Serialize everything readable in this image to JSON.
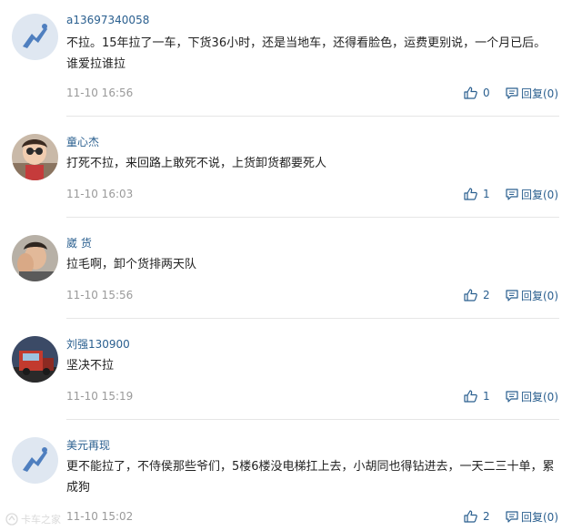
{
  "comments": [
    {
      "username": "a13697340058",
      "text": "不拉。15年拉了一车，下货36小时，还是当地车，还得看脸色，运费更别说，一个月已后。谁爱拉谁拉",
      "time": "11-10 16:56",
      "likes": "0",
      "reply": "回复(0)"
    },
    {
      "username": "童心杰",
      "text": "打死不拉，来回路上敢死不说，上货卸货都要死人",
      "time": "11-10 16:03",
      "likes": "1",
      "reply": "回复(0)"
    },
    {
      "username": "崴 货",
      "text": "拉毛啊，卸个货排两天队",
      "time": "11-10 15:56",
      "likes": "2",
      "reply": "回复(0)"
    },
    {
      "username": "刘强130900",
      "text": "坚决不拉",
      "time": "11-10 15:19",
      "likes": "1",
      "reply": "回复(0)"
    },
    {
      "username": "美元再现",
      "text": "更不能拉了，不侍侯那些爷们，5楼6楼没电梯扛上去，小胡同也得钻进去，一天二三十单，累成狗",
      "time": "11-10 15:02",
      "likes": "2",
      "reply": "回复(0)"
    }
  ],
  "watermark": "卡车之家",
  "colors": {
    "username": "#2a5f8f",
    "text": "#222222",
    "time": "#9a9a9a",
    "action": "#2a5f8f",
    "divider": "#e6e6e6",
    "default_avatar_bg": "#dfe7f1",
    "default_avatar_icon": "#4f7fbf"
  }
}
